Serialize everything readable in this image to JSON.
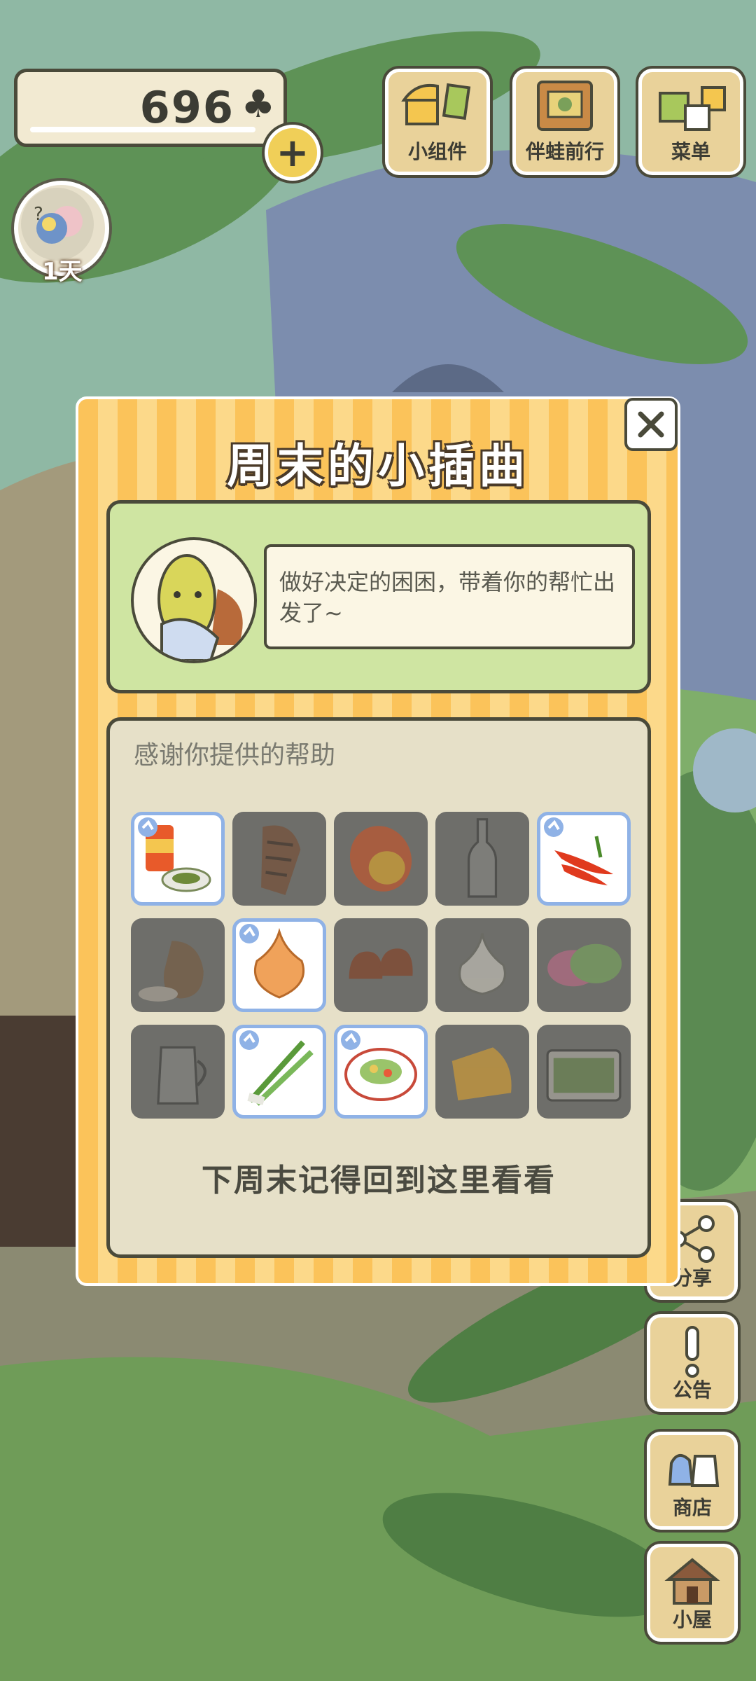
{
  "currency": {
    "amount": "696",
    "icon": "clover-icon"
  },
  "day_badge": {
    "label": "1天"
  },
  "top_buttons": [
    {
      "label": "小组件",
      "icon": "widget-icon"
    },
    {
      "label": "伴蛙前行",
      "icon": "frog-companion-icon"
    },
    {
      "label": "菜单",
      "icon": "menu-icon"
    }
  ],
  "side_buttons": [
    {
      "label": "分享",
      "icon": "share-icon"
    },
    {
      "label": "公告",
      "icon": "notice-icon"
    },
    {
      "label": "商店",
      "icon": "shop-icon"
    },
    {
      "label": "小屋",
      "icon": "house-icon"
    }
  ],
  "modal": {
    "title": "周末的小插曲",
    "story_text": "做好决定的困困，带着你的帮忙出发了~",
    "items_heading": "感谢你提供的帮助",
    "footer": "下周末记得回到这里看看",
    "items": [
      {
        "name": "canned-food",
        "selected": true
      },
      {
        "name": "pinecone",
        "selected": false
      },
      {
        "name": "mango",
        "selected": false
      },
      {
        "name": "bottle",
        "selected": false
      },
      {
        "name": "chili-peppers",
        "selected": true
      },
      {
        "name": "rice-sack",
        "selected": false
      },
      {
        "name": "onion",
        "selected": true
      },
      {
        "name": "chestnuts",
        "selected": false
      },
      {
        "name": "garlic",
        "selected": false
      },
      {
        "name": "rice-dumplings",
        "selected": false
      },
      {
        "name": "milk-jug",
        "selected": false
      },
      {
        "name": "green-onion",
        "selected": true
      },
      {
        "name": "salad-plate",
        "selected": true
      },
      {
        "name": "cheese",
        "selected": false
      },
      {
        "name": "bento-box",
        "selected": false
      }
    ]
  },
  "colors": {
    "modal_stripe": "#fbc35a",
    "selected_border": "#8fb2e6",
    "panel_green": "#cfe5a2"
  }
}
